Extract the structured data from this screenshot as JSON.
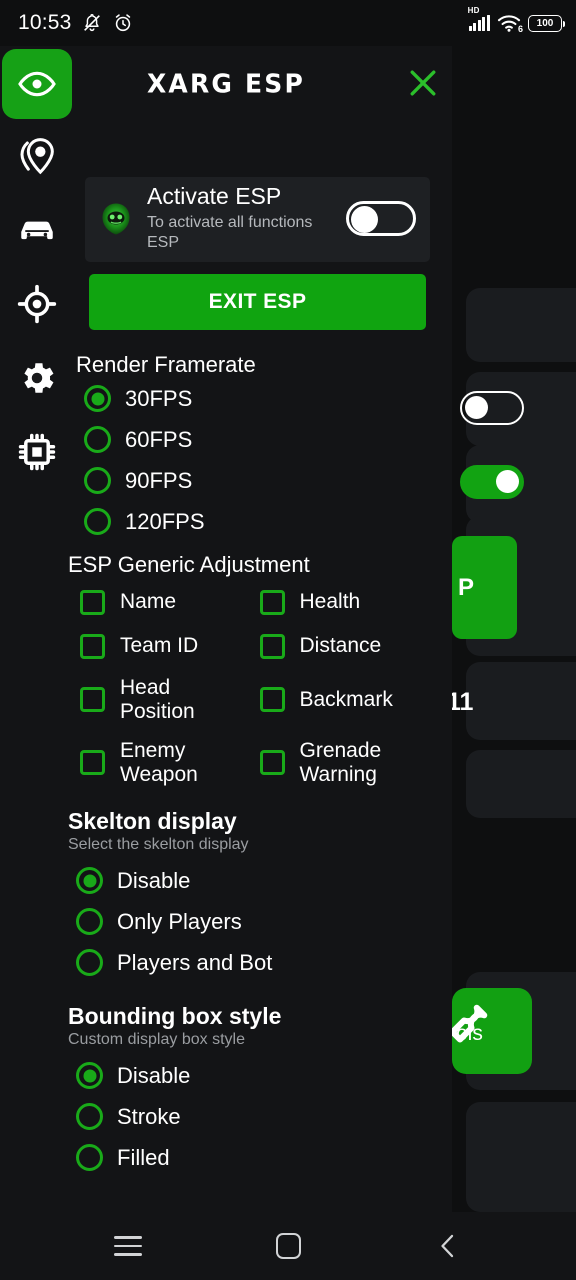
{
  "status_bar": {
    "time": "10:53",
    "mute_icon": "bell-slash-icon",
    "alarm_icon": "alarm-clock-icon",
    "network_label": "HD",
    "wifi_label": "6",
    "battery_level": "100"
  },
  "sidebar": {
    "items": [
      {
        "name": "sidebar-item-esp",
        "icon": "eye-icon",
        "active": true
      },
      {
        "name": "sidebar-item-location",
        "icon": "map-pin-icon",
        "active": false
      },
      {
        "name": "sidebar-item-vehicle",
        "icon": "car-icon",
        "active": false
      },
      {
        "name": "sidebar-item-aim",
        "icon": "crosshair-icon",
        "active": false
      },
      {
        "name": "sidebar-item-settings",
        "icon": "gear-icon",
        "active": false
      },
      {
        "name": "sidebar-item-memory",
        "icon": "cpu-chip-icon",
        "active": false
      }
    ]
  },
  "overlay": {
    "title": "XARG ESP",
    "close_icon": "close-x-icon",
    "activate_card": {
      "logo_icon": "app-logo-icon",
      "title": "Activate ESP",
      "subtitle": "To activate all functions ESP",
      "toggle_name": "activate-esp-toggle",
      "toggle_on": false
    },
    "exit_button": "EXIT ESP",
    "sections": [
      {
        "id": "render-framerate",
        "heading": "Render Framerate",
        "subheading": "",
        "type": "radio",
        "options": [
          {
            "label": "30FPS",
            "selected": true
          },
          {
            "label": "60FPS",
            "selected": false
          },
          {
            "label": "90FPS",
            "selected": false
          },
          {
            "label": "120FPS",
            "selected": false
          }
        ]
      },
      {
        "id": "esp-generic-adjustment",
        "heading": "ESP Generic Adjustment",
        "subheading": "",
        "type": "checkbox",
        "options": [
          {
            "label": "Name",
            "checked": false
          },
          {
            "label": "Health",
            "checked": false
          },
          {
            "label": "Team ID",
            "checked": false
          },
          {
            "label": "Distance",
            "checked": false
          },
          {
            "label": "Head Position",
            "checked": false
          },
          {
            "label": "Backmark",
            "checked": false
          },
          {
            "label": "Enemy Weapon",
            "checked": false
          },
          {
            "label": "Grenade Warning",
            "checked": false
          }
        ]
      },
      {
        "id": "skelton-display",
        "heading": "Skelton display",
        "subheading": "Select the skelton display",
        "type": "radio",
        "options": [
          {
            "label": "Disable",
            "selected": true
          },
          {
            "label": "Only Players",
            "selected": false
          },
          {
            "label": "Players and Bot",
            "selected": false
          }
        ]
      },
      {
        "id": "bounding-box-style",
        "heading": "Bounding box style",
        "subheading": "Custom display box style",
        "type": "radio",
        "options": [
          {
            "label": "Disable",
            "selected": true
          },
          {
            "label": "Stroke",
            "selected": false
          },
          {
            "label": "Filled",
            "selected": false
          }
        ]
      }
    ]
  },
  "background_app": {
    "partial_button_label": "P",
    "partial_text": "11",
    "partial_tools_label": "ols",
    "toggle_off_name": "background-toggle-off",
    "toggle_on_name": "background-toggle-on"
  },
  "nav_bar": {
    "recents_icon": "recents-icon",
    "home_icon": "home-icon",
    "back_icon": "back-chevron-icon"
  },
  "colors": {
    "accent_green": "#12a012",
    "bright_green": "#19aa19",
    "panel_bg": "#131416",
    "card_bg": "#1e2023",
    "page_bg": "#0e0f10"
  }
}
